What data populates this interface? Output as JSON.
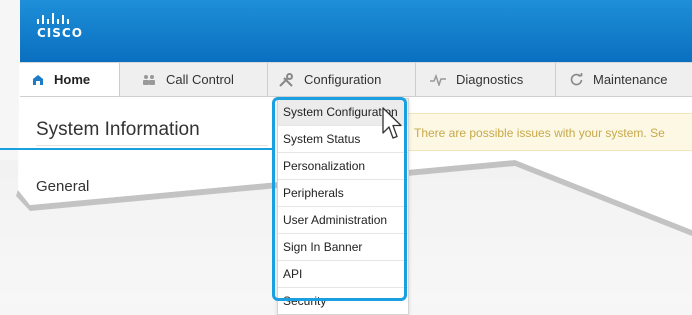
{
  "brand": {
    "logo_text": "CISCO",
    "logo_icon": "cisco-bars-logo"
  },
  "colors": {
    "header": "#0a6fc0",
    "highlight": "#1a9fe0",
    "warning_bg": "#fcf8e3",
    "warning_text": "#c7a94a"
  },
  "nav": {
    "items": [
      {
        "label": "Home",
        "icon": "home-icon",
        "active": true
      },
      {
        "label": "Call Control",
        "icon": "users-icon"
      },
      {
        "label": "Configuration",
        "icon": "tools-icon"
      },
      {
        "label": "Diagnostics",
        "icon": "pulse-icon"
      },
      {
        "label": "Maintenance",
        "icon": "refresh-icon"
      }
    ]
  },
  "page": {
    "title": "System Information",
    "section": "General",
    "warning": "There are possible issues with your system. Se"
  },
  "config_menu": {
    "items": [
      {
        "label": "System Configuration",
        "hovered": true
      },
      {
        "label": "System Status"
      },
      {
        "label": "Personalization"
      },
      {
        "label": "Peripherals"
      },
      {
        "label": "User Administration"
      },
      {
        "label": "Sign In Banner"
      },
      {
        "label": "API"
      },
      {
        "label": "Security"
      }
    ]
  }
}
